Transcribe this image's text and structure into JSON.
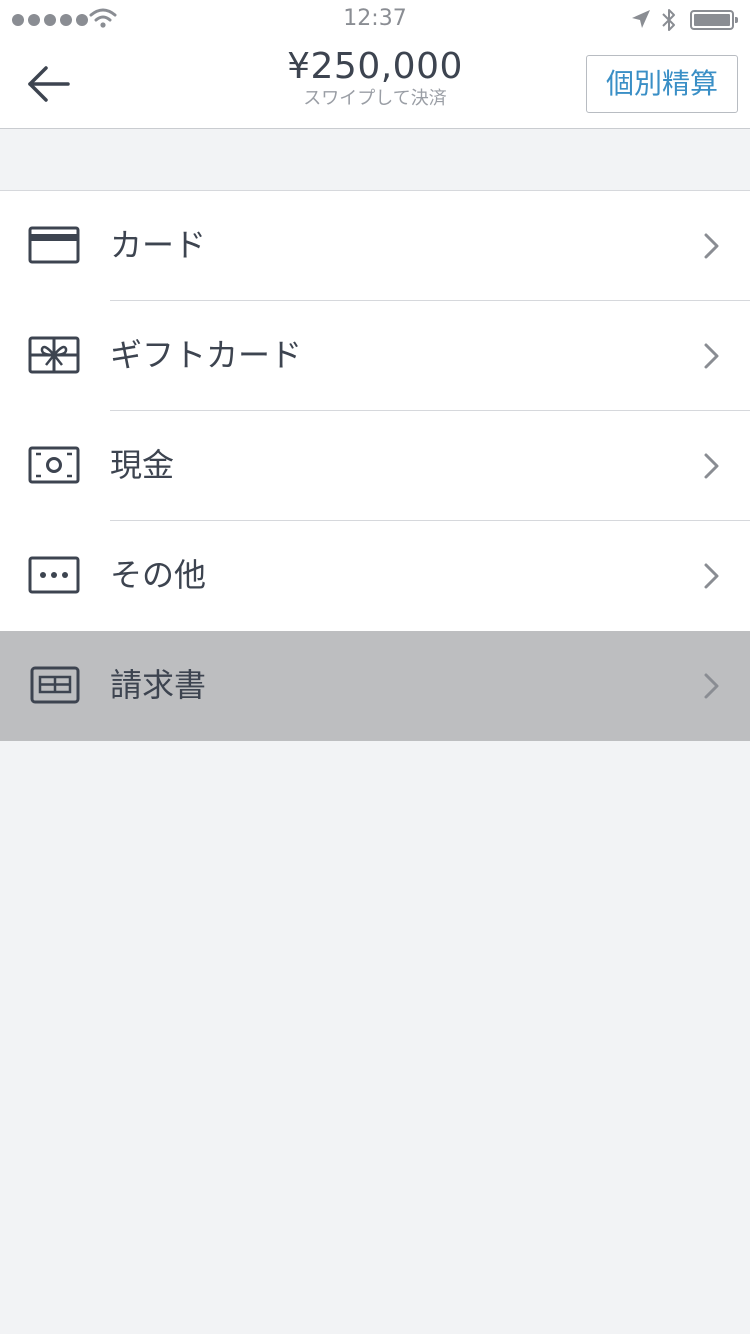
{
  "status_bar": {
    "time": "12:37",
    "icons": [
      "signal-dots-icon",
      "wifi-icon",
      "location-arrow-icon",
      "bluetooth-icon",
      "battery-icon"
    ]
  },
  "nav": {
    "back_icon": "arrow-left-icon",
    "amount": "¥250,000",
    "subtitle": "スワイプして決済",
    "split_button_label": "個別精算",
    "split_button_color": "#3a8fc6"
  },
  "payment_methods": [
    {
      "label": "カード",
      "icon": "credit-card-icon"
    },
    {
      "label": "ギフトカード",
      "icon": "gift-card-icon"
    },
    {
      "label": "現金",
      "icon": "cash-icon"
    },
    {
      "label": "その他",
      "icon": "more-dots-icon"
    },
    {
      "label": "請求書",
      "icon": "invoice-icon",
      "selected": true
    }
  ],
  "colors": {
    "text": "#3d4450",
    "accent": "#3a8fc6",
    "background": "#f2f3f5",
    "selected_row": "#bdbec0"
  }
}
